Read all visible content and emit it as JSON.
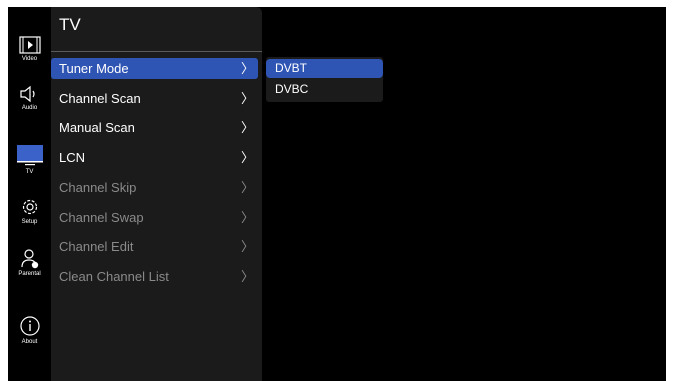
{
  "rail": {
    "video": "Video",
    "audio": "Audio",
    "tv": "TV",
    "setup": "Setup",
    "parental": "Parental",
    "about": "About"
  },
  "panel": {
    "title": "TV",
    "items": [
      {
        "label": "Tuner Mode",
        "chevron": "〉",
        "state": "selected"
      },
      {
        "label": "Channel Scan",
        "chevron": "〉",
        "state": "enabled"
      },
      {
        "label": "Manual Scan",
        "chevron": "〉",
        "state": "enabled"
      },
      {
        "label": "LCN",
        "chevron": "〉",
        "state": "enabled"
      },
      {
        "label": "Channel Skip",
        "chevron": "〉",
        "state": "disabled"
      },
      {
        "label": "Channel Swap",
        "chevron": "〉",
        "state": "disabled"
      },
      {
        "label": "Channel Edit",
        "chevron": "〉",
        "state": "disabled"
      },
      {
        "label": "Clean Channel List",
        "chevron": "〉",
        "state": "disabled"
      }
    ]
  },
  "submenu": {
    "options": [
      {
        "label": "DVBT",
        "selected": true
      },
      {
        "label": "DVBC",
        "selected": false
      }
    ]
  },
  "colors": {
    "accent": "#2f55b4",
    "panel": "#1b1b1b",
    "disabled_text": "#8a8a8a",
    "tv_icon": "#3a62c9"
  }
}
